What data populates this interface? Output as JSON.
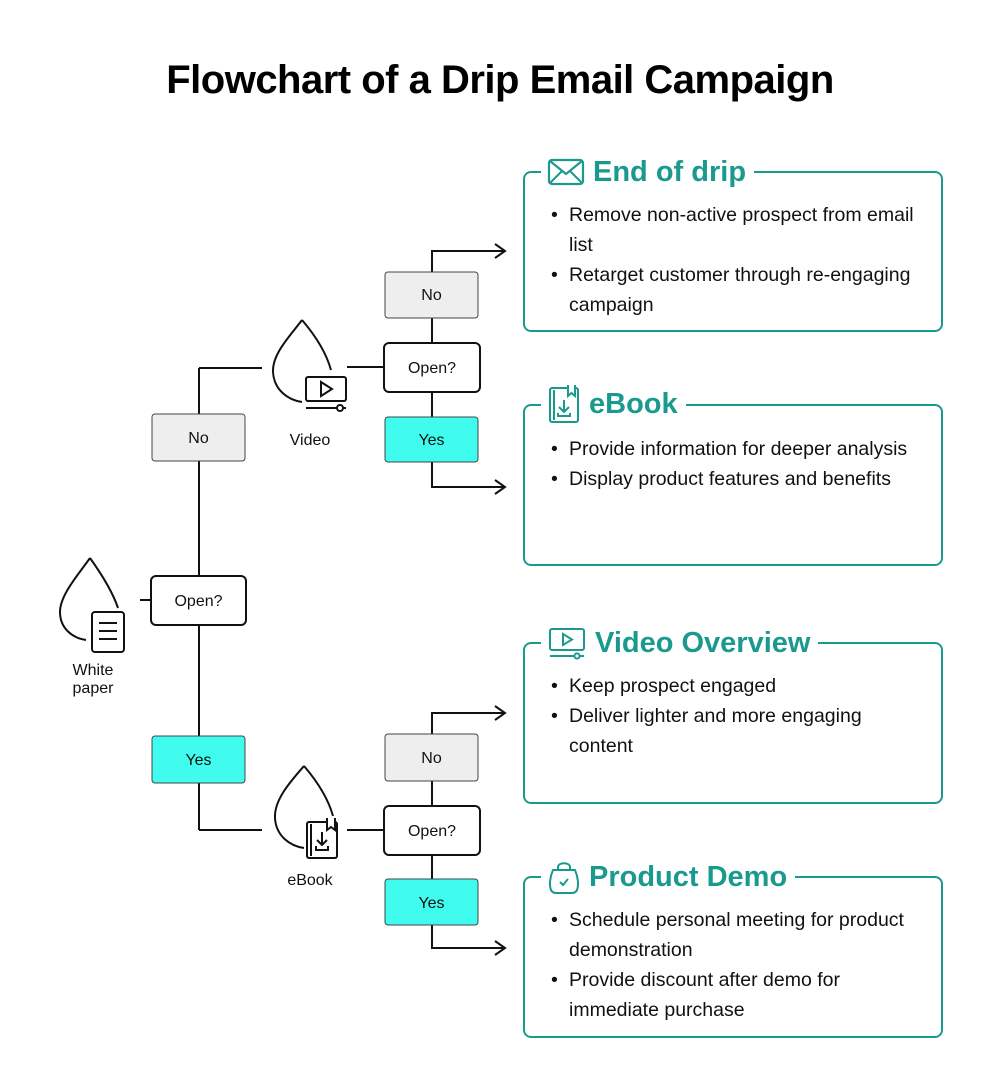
{
  "title": "Flowchart of a Drip Email Campaign",
  "colors": {
    "accent": "#1a9a8e",
    "yes_fill": "#40fcef",
    "no_fill": "#eeeeee",
    "line": "#111111"
  },
  "start": {
    "label_line1": "White",
    "label_line2": "paper",
    "icon": "document-icon",
    "decision": "Open?"
  },
  "branches": {
    "no": {
      "label": "No",
      "content": {
        "label": "Video",
        "icon": "video-icon",
        "decision": "Open?",
        "no": "No",
        "yes": "Yes"
      }
    },
    "yes": {
      "label": "Yes",
      "content": {
        "label": "eBook",
        "icon": "ebook-icon",
        "decision": "Open?",
        "no": "No",
        "yes": "Yes"
      }
    }
  },
  "outcomes": [
    {
      "title": "End of drip",
      "icon": "mail-icon",
      "bullets": [
        "Remove non-active prospect from email list",
        "Retarget customer through re-engaging campaign"
      ]
    },
    {
      "title": "eBook",
      "icon": "ebook-icon",
      "bullets": [
        "Provide information for deeper analysis",
        "Display product features and benefits"
      ]
    },
    {
      "title": "Video Overview",
      "icon": "video-icon",
      "bullets": [
        "Keep prospect engaged",
        "Deliver lighter and more engaging content"
      ]
    },
    {
      "title": "Product Demo",
      "icon": "shopping-bag-icon",
      "bullets": [
        "Schedule personal meeting for product demonstration",
        "Provide discount after demo for immediate purchase"
      ]
    }
  ]
}
